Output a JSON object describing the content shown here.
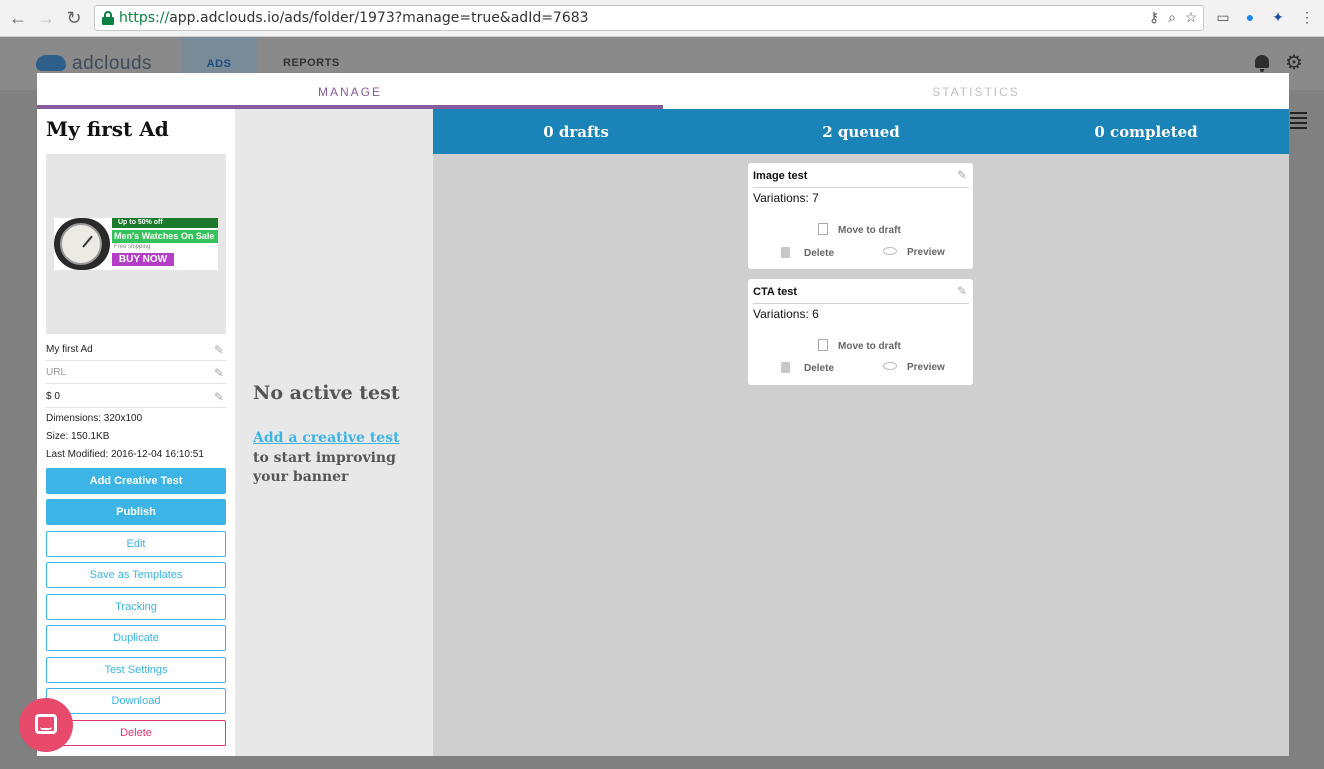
{
  "browser": {
    "url_scheme": "https://",
    "url_rest": "app.adclouds.io/ads/folder/1973?manage=true&adId=7683"
  },
  "app": {
    "logo": "adclouds",
    "tabs": [
      "ADS",
      "REPORTS"
    ]
  },
  "modal": {
    "tabs": [
      "MANAGE",
      "STATISTICS"
    ]
  },
  "ad": {
    "title": "My first Ad",
    "banner": {
      "badge": "Up to 50% off",
      "headline": "Men's Watches On Sale",
      "sub": "Free shipping",
      "cta": "BUY NOW"
    },
    "fields": {
      "name": "My first Ad",
      "url_placeholder": "URL",
      "budget": "$ 0"
    },
    "meta": {
      "dimensions": "Dimensions: 320x100",
      "size": "Size: 150.1KB",
      "modified": "Last Modified: 2016-12-04 16:10:51"
    },
    "buttons": {
      "add_test": "Add Creative Test",
      "publish": "Publish",
      "edit": "Edit",
      "save_template": "Save as Templates",
      "tracking": "Tracking",
      "duplicate": "Duplicate",
      "test_settings": "Test Settings",
      "download": "Download",
      "delete": "Delete"
    }
  },
  "middle": {
    "no_test": "No active test",
    "add_link": "Add a creative test",
    "add_desc": "to start improving your banner"
  },
  "status": {
    "drafts": "0 drafts",
    "queued": "2 queued",
    "completed": "0 completed"
  },
  "tests": [
    {
      "title": "Image test",
      "variations": "Variations: 7",
      "move": "Move to draft",
      "delete": "Delete",
      "preview": "Preview"
    },
    {
      "title": "CTA test",
      "variations": "Variations: 6",
      "move": "Move to draft",
      "delete": "Delete",
      "preview": "Preview"
    }
  ],
  "colors": {
    "accent": "#3cb4e5",
    "manage_tab": "#8a5a9e",
    "status_bar": "#1a83b8",
    "danger": "#e0356b",
    "chat": "#e84a6c"
  },
  "icons": [
    "back-icon",
    "forward-icon",
    "reload-icon",
    "lock-icon",
    "key-icon",
    "zoom-icon",
    "star-icon",
    "cast-icon",
    "extension-icon",
    "menu-dots-icon",
    "bell-icon",
    "gear-icon",
    "pencil-icon",
    "document-icon",
    "trash-icon",
    "eye-icon",
    "chat-icon"
  ]
}
